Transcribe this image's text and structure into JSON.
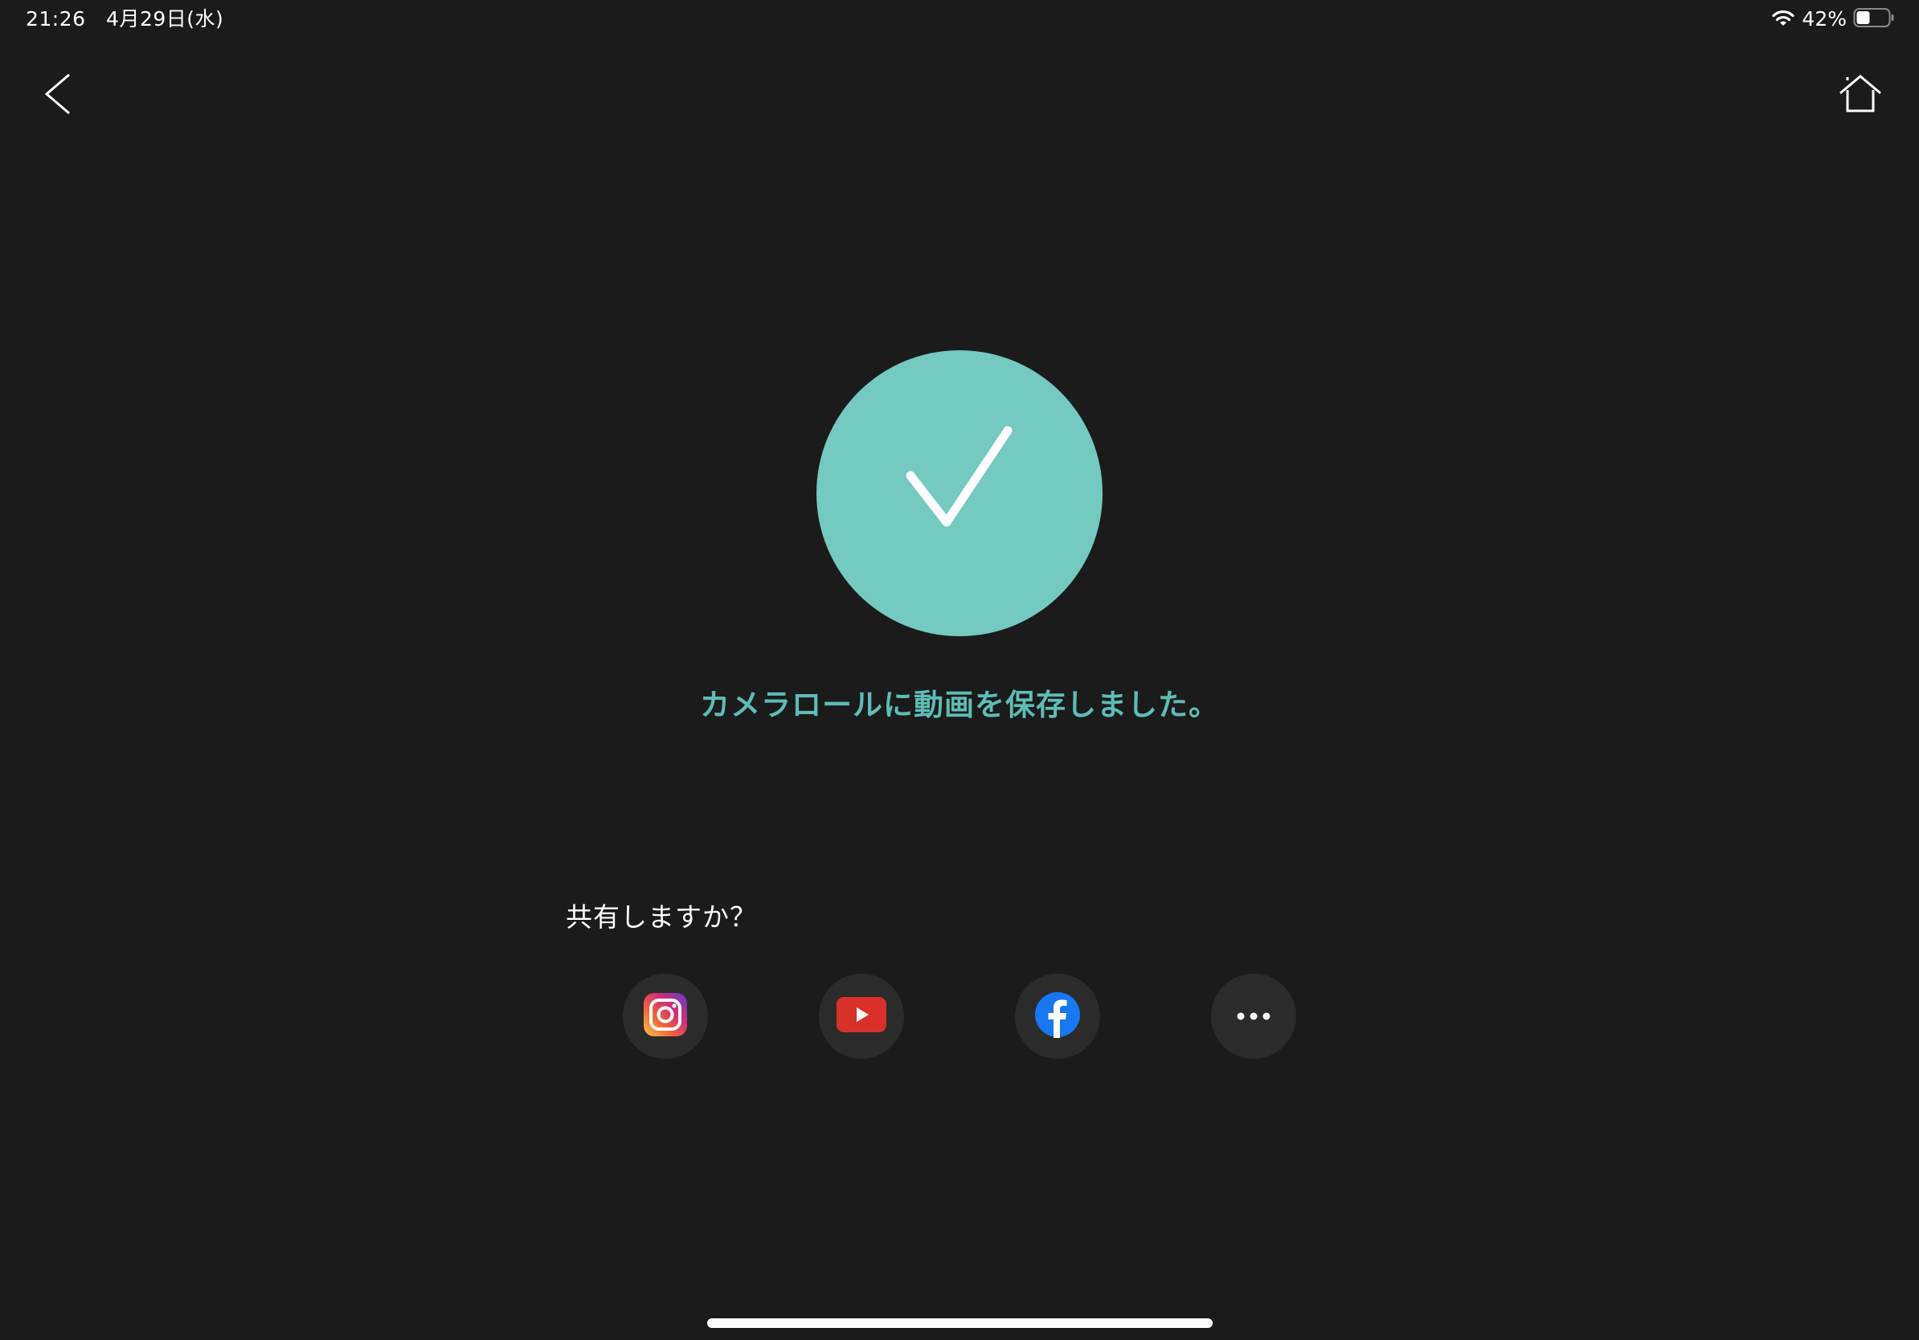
{
  "status_bar": {
    "time": "21:26　4月29日(水)",
    "battery_percent": "42%",
    "battery_level": 0.42
  },
  "nav": {
    "back_icon": "chevron-left-icon",
    "home_icon": "home-icon"
  },
  "success": {
    "icon": "checkmark-icon",
    "message": "カメラロールに動画を保存しました。"
  },
  "share": {
    "prompt": "共有しますか？",
    "targets": [
      {
        "name": "instagram",
        "icon": "instagram-icon"
      },
      {
        "name": "youtube",
        "icon": "youtube-icon"
      },
      {
        "name": "facebook",
        "icon": "facebook-icon"
      },
      {
        "name": "more",
        "icon": "more-icon"
      }
    ]
  },
  "colors": {
    "background": "#1b1b1b",
    "accent": "#74c9c0",
    "accent_text": "#5ebdb6",
    "share_button_bg": "#2b2b2b",
    "youtube_red": "#d9302a",
    "facebook_blue": "#1877f2"
  }
}
